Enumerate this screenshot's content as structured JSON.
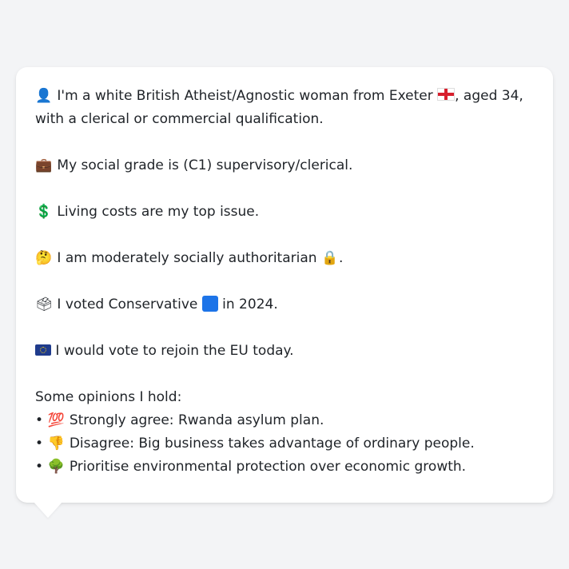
{
  "bio": {
    "identity": {
      "icon": "person-silhouette-icon",
      "text_before": "I'm a white British Atheist/Agnostic woman from Exeter",
      "flag": "england-flag-icon",
      "text_after": ", aged 34, with a clerical or commercial qualification."
    },
    "social_grade": {
      "icon": "briefcase-icon",
      "glyph": "💼",
      "text": "My social grade is (C1) supervisory/clerical."
    },
    "top_issue": {
      "icon": "dollar-sign-icon",
      "glyph": "💲",
      "text": "Living costs are my top issue."
    },
    "ideology": {
      "icon": "thinking-face-icon",
      "glyph": "🤔",
      "text": "I am moderately socially authoritarian",
      "trail_icon": "padlock-icon",
      "trail_glyph": "🔒",
      "end": "."
    },
    "vote": {
      "icon": "ballot-box-icon",
      "glyph": "🗳",
      "text_before": "I voted Conservative",
      "party_icon": "blue-square-icon",
      "party_color": "#1d74e8",
      "text_after": "in 2024."
    },
    "eu": {
      "icon": "eu-flag-icon",
      "text": "I would vote to rejoin the EU today."
    }
  },
  "opinions": {
    "heading": "Some opinions I hold:",
    "bullet": "•",
    "items": [
      {
        "icon": "hundred-points-icon",
        "glyph": "💯",
        "text": "Strongly agree: Rwanda asylum plan."
      },
      {
        "icon": "thumbs-down-icon",
        "glyph": "👎",
        "text": "Disagree: Big business takes advantage of ordinary people."
      },
      {
        "icon": "deciduous-tree-icon",
        "glyph": "🌳",
        "text": "Prioritise environmental protection over economic growth."
      }
    ]
  }
}
